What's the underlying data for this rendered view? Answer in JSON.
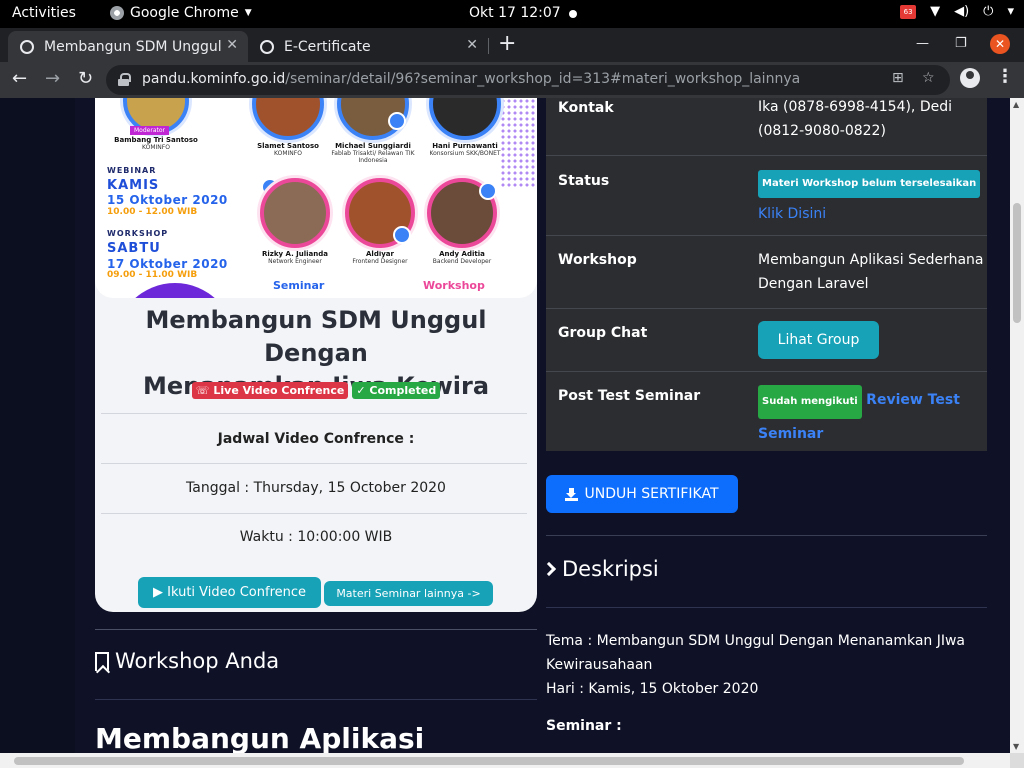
{
  "topbar": {
    "activities": "Activities",
    "app_name": "Google Chrome",
    "clock": "Okt 17  12:07",
    "notif_badge": "63"
  },
  "tabs": [
    {
      "title": "Membangun SDM Unggul",
      "active": true
    },
    {
      "title": "E-Certificate",
      "active": false
    }
  ],
  "address": {
    "host": "pandu.kominfo.go.id",
    "path": "/seminar/detail/96?seminar_workshop_id=313#materi_workshop_lainnya"
  },
  "poster": {
    "moderator_tag": "Moderator",
    "moderator_name": "Bambang Tri Santoso",
    "moderator_org": "KOMINFO",
    "speakers": [
      {
        "name": "Slamet Santoso",
        "role": "KOMINFO"
      },
      {
        "name": "Michael Sunggiardi",
        "role": "Fablab Trisakti/ Relawan TIK Indonesia"
      },
      {
        "name": "Hani Purnawanti",
        "role": "Konsorsium SKK/BONET"
      }
    ],
    "trainers": [
      {
        "name": "Rizky A. Julianda",
        "role": "Network Engineer"
      },
      {
        "name": "Aldiyar",
        "role": "Frontend Designer"
      },
      {
        "name": "Andy Aditia",
        "role": "Backend Developer"
      }
    ],
    "webinar_label": "WEBINAR",
    "webinar_day": "KAMIS",
    "webinar_date": "15 Oktober 2020",
    "webinar_time": "10.00 - 12.00 WIB",
    "workshop_label": "WORKSHOP",
    "workshop_day": "SABTU",
    "workshop_date": "17 Oktober 2020",
    "workshop_time": "09.00 - 11.00 WIB",
    "tag_seminar": "Seminar",
    "tag_workshop": "Workshop"
  },
  "card": {
    "title_line1": "Membangun SDM Unggul Dengan",
    "title_line2": "Menanamkan Jiwa Kewira",
    "badge_live": "Live Video Confrence",
    "badge_completed": "Completed",
    "schedule_heading": "Jadwal Video Confrence :",
    "tanggal": "Tanggal : Thursday, 15 October 2020",
    "waktu": "Waktu : 10:00:00 WIB",
    "join_button": "Ikuti Video Confrence",
    "other_materials_button": "Materi Seminar lainnya ->"
  },
  "workshop_section": {
    "heading": "Workshop Anda",
    "title_preview": "Membangun Aplikasi"
  },
  "info": {
    "kontak_label": "Kontak",
    "kontak_line1": "Ika (0878-6998-4154), Dedi",
    "kontak_line2": "(0812-9080-0822)",
    "status_label": "Status",
    "status_badge": "Materi Workshop belum terselesaikan",
    "status_link": "Klik Disini",
    "workshop_label": "Workshop",
    "workshop_line1": "Membangun Aplikasi Sederhana",
    "workshop_line2": "Dengan Laravel",
    "group_label": "Group Chat",
    "group_button": "Lihat Group",
    "posttest_label": "Post Test Seminar",
    "posttest_badge": "Sudah mengikuti",
    "posttest_link1": "Review Test",
    "posttest_link2": "Seminar"
  },
  "download_button": "UNDUH SERTIFIKAT",
  "deskripsi": {
    "heading": "Deskripsi",
    "tema_line1": "Tema  : Membangun SDM Unggul Dengan Menanamkan JIwa",
    "tema_line2": "Kewirausahaan",
    "hari": "Hari     : Kamis, 15 Oktober 2020",
    "seminar_label": "Seminar :"
  },
  "colors": {
    "teal": "#17a2b8",
    "blue": "#0d6efd",
    "link_blue": "#3b82f6",
    "danger": "#dc3545",
    "success": "#28a745",
    "page_bg": "#0f1226",
    "table_bg": "#2b2d31"
  }
}
